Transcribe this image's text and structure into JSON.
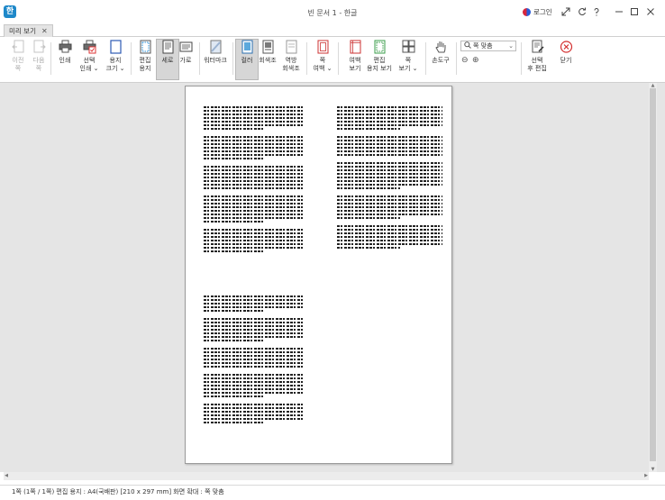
{
  "window": {
    "title": "빈 문서 1 - 한글",
    "login": "로그인",
    "app_logo": "한"
  },
  "tab": {
    "label": "미리 보기",
    "close": "✕"
  },
  "ribbon": {
    "prev": [
      "이전",
      "쪽"
    ],
    "next": [
      "다음",
      "쪽"
    ],
    "print": "인쇄",
    "select_print": [
      "선택",
      "인쇄 ⌄"
    ],
    "paper_size": [
      "용지",
      "크기 ⌄"
    ],
    "edit_paper": [
      "편집",
      "용지"
    ],
    "portrait": "세로",
    "landscape": "가로",
    "watermark": "워터마크",
    "color": "컬러",
    "grayscale": "회색조",
    "inverse": [
      "역방",
      "회색조"
    ],
    "page_margin": [
      "쪽",
      "여백 ⌄"
    ],
    "margin_view": [
      "여백",
      "보기"
    ],
    "edit_paper_view": [
      "편집",
      "용지 보기"
    ],
    "page_view": [
      "쪽",
      "보기 ⌄"
    ],
    "hand_tool": "손도구",
    "zoom_select": "쪽 맞춤",
    "zoom_out": "⊖",
    "zoom_in": "⊕",
    "select_edit": [
      "선택",
      "후 편집"
    ],
    "close": "닫기"
  },
  "status": {
    "text": "1쪽 (1쪽 / 1쪽)  편집 용지 : A4(국배판) [210 x 297 mm]  화면 확대 : 쪽 맞춤"
  }
}
